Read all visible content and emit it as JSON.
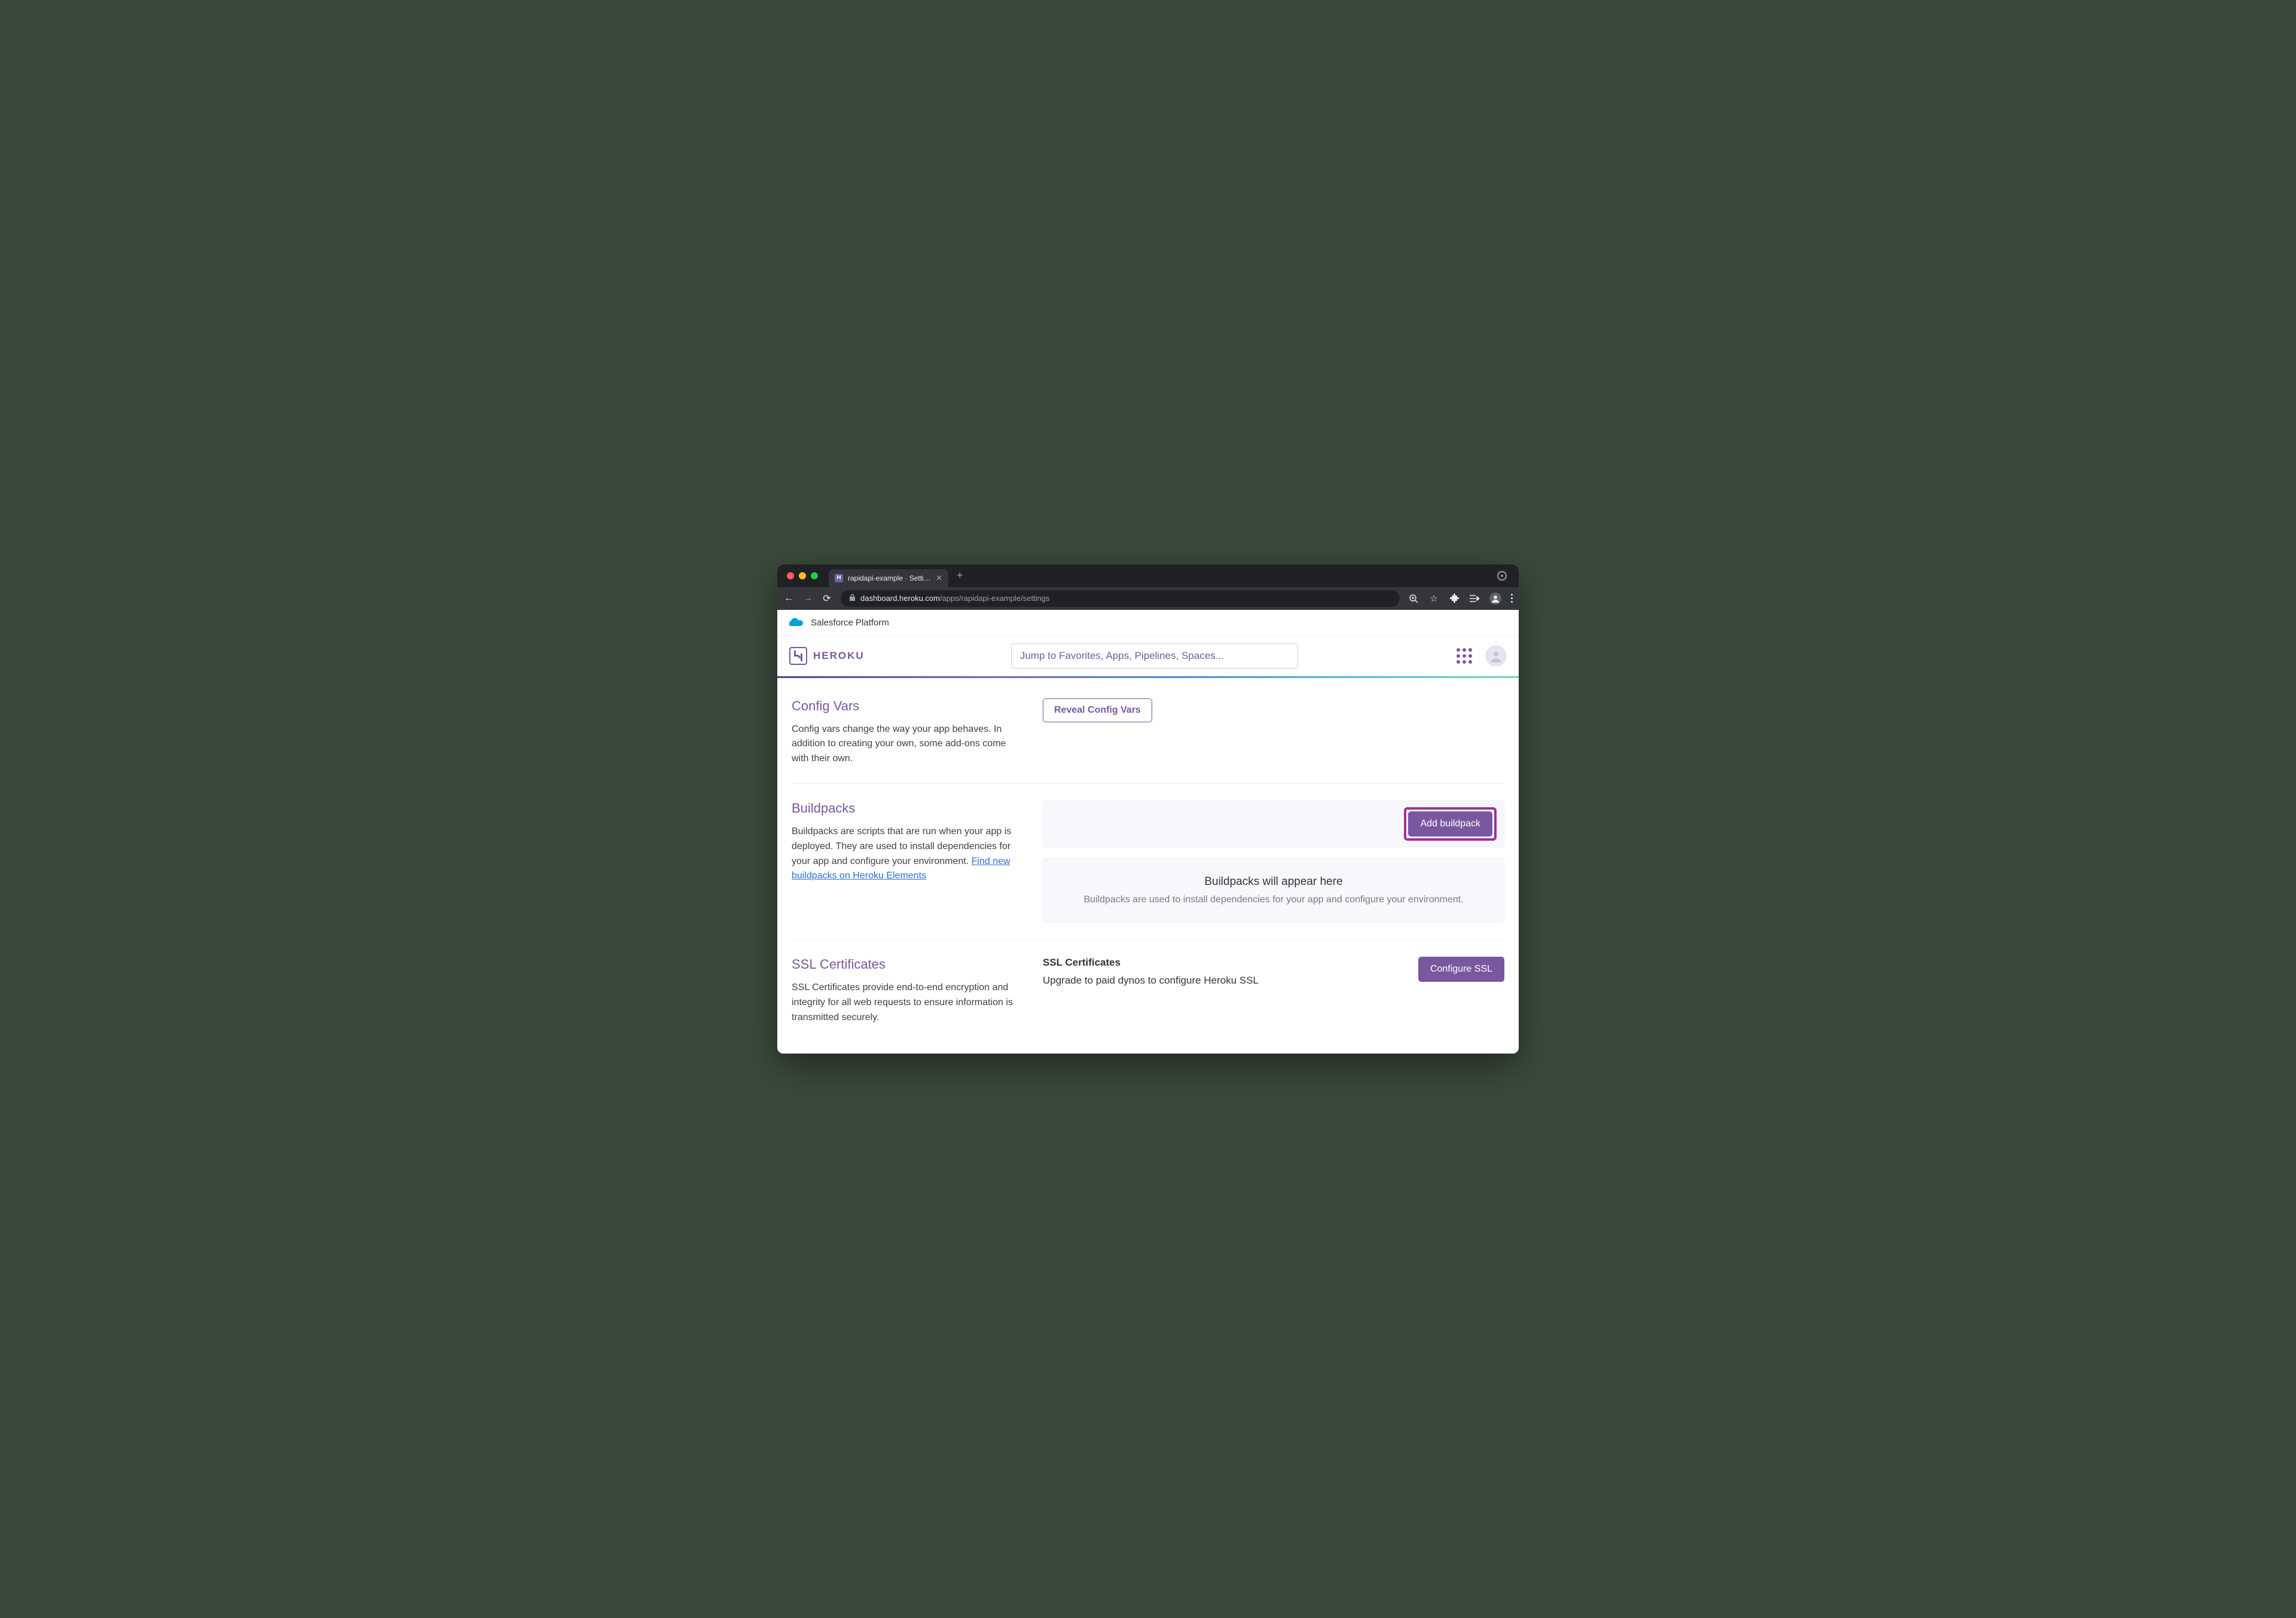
{
  "browser": {
    "tab_title": "rapidapi-example · Settings | H",
    "url_domain": "dashboard.heroku.com",
    "url_path": "/apps/rapidapi-example/settings"
  },
  "salesforce_bar": "Salesforce Platform",
  "header": {
    "brand": "HEROKU",
    "search_placeholder": "Jump to Favorites, Apps, Pipelines, Spaces..."
  },
  "config_vars": {
    "title": "Config Vars",
    "desc": "Config vars change the way your app behaves. In addition to creating your own, some add-ons come with their own.",
    "button": "Reveal Config Vars"
  },
  "buildpacks": {
    "title": "Buildpacks",
    "desc_pre": "Buildpacks are scripts that are run when your app is deployed. They are used to install dependencies for your app and configure your environment. ",
    "link": "Find new buildpacks on Heroku Elements",
    "add_button": "Add buildpack",
    "empty_title": "Buildpacks will appear here",
    "empty_sub": "Buildpacks are used to install dependencies for your app and configure your environment."
  },
  "ssl": {
    "title": "SSL Certificates",
    "desc": "SSL Certificates provide end-to-end encryption and integrity for all web requests to ensure information is transmitted securely.",
    "panel_title": "SSL Certificates",
    "message": "Upgrade to paid dynos to configure Heroku SSL",
    "button": "Configure SSL"
  }
}
